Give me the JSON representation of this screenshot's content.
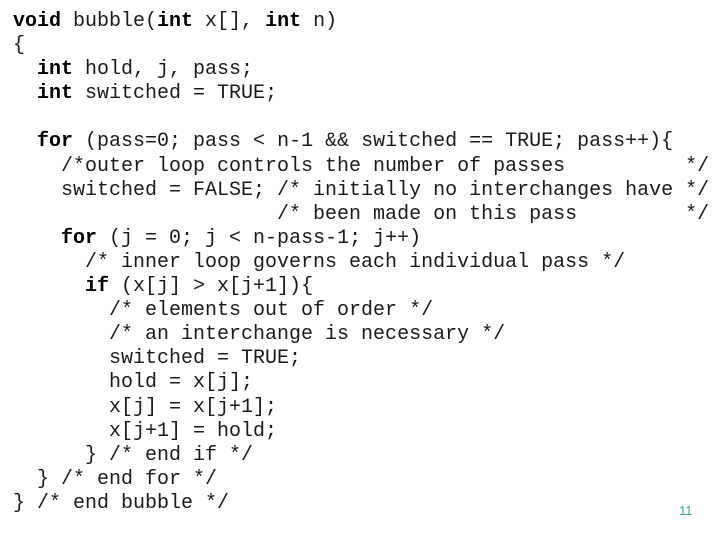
{
  "slide": {
    "page_number": "11",
    "page_number_color": "#3aa89a",
    "code_lines": [
      [
        {
          "t": "void",
          "kw": true
        },
        {
          "t": " bubble("
        },
        {
          "t": "int",
          "kw": true
        },
        {
          "t": " x[], "
        },
        {
          "t": "int",
          "kw": true
        },
        {
          "t": " n)"
        }
      ],
      [
        {
          "t": "{"
        }
      ],
      [
        {
          "t": "  "
        },
        {
          "t": "int",
          "kw": true
        },
        {
          "t": " hold, j, pass;"
        }
      ],
      [
        {
          "t": "  "
        },
        {
          "t": "int",
          "kw": true
        },
        {
          "t": " switched = TRUE;"
        }
      ],
      [
        {
          "t": ""
        }
      ],
      [
        {
          "t": "  "
        },
        {
          "t": "for",
          "kw": true
        },
        {
          "t": " (pass=0; pass < n-1 && switched == TRUE; pass++){"
        }
      ],
      [
        {
          "t": "    /*outer loop controls the number of passes          */"
        }
      ],
      [
        {
          "t": "    switched = FALSE; /* initially no interchanges have */"
        }
      ],
      [
        {
          "t": "                      /* been made on this pass         */"
        }
      ],
      [
        {
          "t": "    "
        },
        {
          "t": "for",
          "kw": true
        },
        {
          "t": " (j = 0; j < n-pass-1; j++)"
        }
      ],
      [
        {
          "t": "      /* inner loop governs each individual pass */"
        }
      ],
      [
        {
          "t": "      "
        },
        {
          "t": "if",
          "kw": true
        },
        {
          "t": " (x[j] > x[j+1]){"
        }
      ],
      [
        {
          "t": "        /* elements out of order */"
        }
      ],
      [
        {
          "t": "        /* an interchange is necessary */"
        }
      ],
      [
        {
          "t": "        switched = TRUE;"
        }
      ],
      [
        {
          "t": "        hold = x[j];"
        }
      ],
      [
        {
          "t": "        x[j] = x[j+1];"
        }
      ],
      [
        {
          "t": "        x[j+1] = hold;"
        }
      ],
      [
        {
          "t": "      } /* end if */"
        }
      ],
      [
        {
          "t": "  } /* end for */"
        }
      ],
      [
        {
          "t": "} /* end bubble */"
        }
      ]
    ]
  }
}
